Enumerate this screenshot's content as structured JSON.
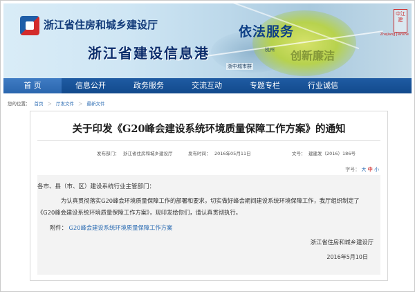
{
  "banner": {
    "dept_name": "浙江省住房和城乡建设厅",
    "site_name": "浙江省建设信息港",
    "slogan": "依法服务",
    "slogan2": "创新廉洁",
    "map_label_1": "浙中城市群",
    "map_label_2": "杭州",
    "seal_text": "中江建",
    "seal_sub": "Zhejiang Jianshe"
  },
  "nav": {
    "items": [
      "首 页",
      "信息公开",
      "政务服务",
      "交流互动",
      "专题专栏",
      "行业诚信"
    ]
  },
  "breadcrumb": {
    "prefix": "您的位置：",
    "links": [
      "首页",
      "厅发文件",
      "最新文件"
    ],
    "sep": "＞"
  },
  "article": {
    "title": "关于印发《G20峰会建设系统环境质量保障工作方案》的通知",
    "meta": {
      "dept_label": "发布部门：",
      "dept_value": "浙江省住房和城乡建设厅",
      "date_label": "发布时间：",
      "date_value": "2016年05月11日",
      "doc_label": "文号：",
      "doc_value": "建建发（2016）186号"
    },
    "fontsize": {
      "label": "字号：",
      "big": "大",
      "mid": "中",
      "small": "小"
    },
    "salutation": "各市、县（市、区）建设系统行业主管部门：",
    "body": "为认真贯彻落实G20峰会环境质量保障工作的部署和要求，切实做好峰会期间建设系统环境保障工作，我厅组织制定了《G20峰会建设系统环境质量保障工作方案》，现印发给你们，请认真贯彻执行。",
    "attach_label": "附件：",
    "attach_link": "G20峰会建设系统环境质量保障工作方案",
    "signer": "浙江省住房和城乡建设厅",
    "date": "2016年5月10日"
  },
  "colors": {
    "nav_bg": "#124a8c",
    "link": "#2d6db3",
    "accent_red": "#d43a3a"
  }
}
